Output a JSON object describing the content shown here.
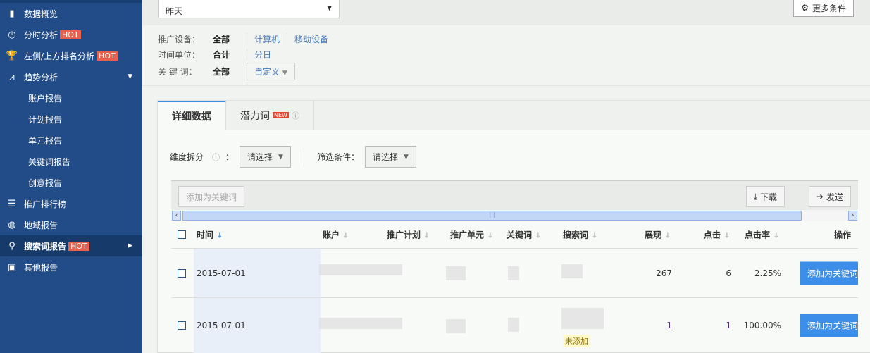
{
  "sidebar": {
    "items": [
      {
        "label": "数据概览",
        "icon": "bar-chart-icon"
      },
      {
        "label": "分时分析",
        "icon": "clock-icon",
        "badge": "HOT"
      },
      {
        "label": "左侧/上方排名分析",
        "icon": "trophy-icon",
        "badge": "HOT"
      },
      {
        "label": "趋势分析",
        "icon": "line-chart-icon"
      },
      {
        "label": "账户报告"
      },
      {
        "label": "计划报告"
      },
      {
        "label": "单元报告"
      },
      {
        "label": "关键词报告"
      },
      {
        "label": "创意报告"
      },
      {
        "label": "推广排行榜",
        "icon": "list-icon"
      },
      {
        "label": "地域报告",
        "icon": "globe-icon"
      },
      {
        "label": "搜索词报告",
        "icon": "search-icon",
        "badge": "HOT",
        "active": true
      },
      {
        "label": "其他报告",
        "icon": "report-icon"
      }
    ]
  },
  "top": {
    "date": "昨天",
    "more": "更多条件"
  },
  "filters": {
    "device": {
      "label": "推广设备：",
      "value": "全部",
      "options": [
        "计算机",
        "移动设备"
      ]
    },
    "unit": {
      "label": "时间单位：",
      "value": "合计",
      "options": [
        "分日"
      ]
    },
    "keyword": {
      "label": "关 键 词：",
      "value": "全部",
      "custom": "自定义"
    }
  },
  "tabs": [
    {
      "label": "详细数据",
      "active": true
    },
    {
      "label": "潜力词",
      "badge": "NEW"
    }
  ],
  "dims": {
    "split_label": "维度拆分",
    "split_value": "请选择",
    "filter_label": "筛选条件：",
    "filter_value": "请选择"
  },
  "toolbar": {
    "add": "添加为关键词",
    "download": "下载",
    "send": "发送"
  },
  "table": {
    "headers": [
      "时间",
      "账户",
      "推广计划",
      "推广单元",
      "关键词",
      "搜索词",
      "展现",
      "点击",
      "点击率",
      "操作"
    ],
    "rows": [
      {
        "time": "2015-07-01",
        "impressions": "267",
        "clicks": "6",
        "ctr": "2.25%",
        "action": "添加为关键词",
        "tag": ""
      },
      {
        "time": "2015-07-01",
        "impressions": "1",
        "clicks": "1",
        "ctr": "100.00%",
        "action": "添加为关键词",
        "tag": "未添加"
      }
    ]
  },
  "colors": {
    "sidebar": "#214c88",
    "accent": "#3c8ee8",
    "hot": "#e8604c"
  }
}
